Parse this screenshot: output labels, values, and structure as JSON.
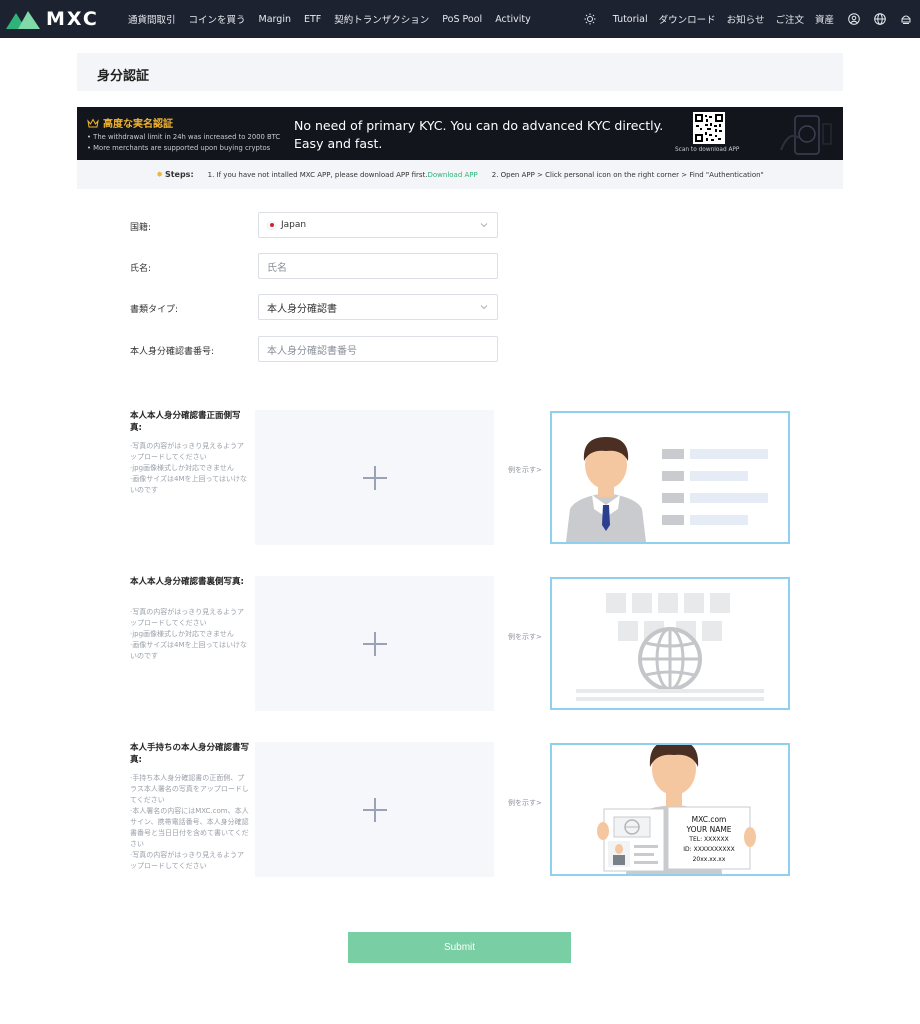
{
  "nav": {
    "brand": "MXC",
    "menu": [
      "通貨間取引",
      "コインを買う",
      "Margin",
      "ETF",
      "契約トランザクション",
      "PoS Pool",
      "Activity"
    ],
    "right_links": [
      "Tutorial",
      "ダウンロード",
      "お知らせ",
      "ご注文",
      "資産"
    ],
    "icons": [
      "sun-icon",
      "user-icon",
      "globe-icon",
      "contract-icon"
    ]
  },
  "page": {
    "title": "身分認証"
  },
  "banner": {
    "title": "高度な実名認証",
    "bullets": [
      "• The withdrawal limit in 24h was increased to 2000 BTC",
      "• More merchants are supported upon buying cryptos"
    ],
    "headline_1": "No need of primary KYC. You can do advanced KYC directly.",
    "headline_2": "Easy and fast.",
    "scan_text": "Scan to download APP"
  },
  "steps": {
    "label": "Steps:",
    "step1_text": "1. If you have not intalled MXC APP, please download APP first.",
    "step1_link": "Download APP",
    "step2_text": "2. Open APP > Click personal icon on the right corner > Find \"Authentication\""
  },
  "form": {
    "nationality": {
      "label": "国籍:",
      "value": "Japan"
    },
    "name": {
      "label": "氏名:",
      "placeholder": "氏名"
    },
    "doc_type": {
      "label": "書類タイプ:",
      "value": "本人身分確認書"
    },
    "doc_number": {
      "label": "本人身分確認書番号:",
      "placeholder": "本人身分確認書番号"
    }
  },
  "uploads": [
    {
      "title": "本人本人身分確認書正面側写真:",
      "notes": [
        "·写真の内容がはっきり見えるようアップロードしてください",
        "·jpg画像様式しか対応できません",
        "·画像サイズは4Mを上回ってはいけないのです"
      ],
      "example": "例を示す>"
    },
    {
      "title": "本人本人身分確認書裏側写真:",
      "notes": [
        "·写真の内容がはっきり見えるようアップロードしてください",
        "·jpg画像様式しか対応できません",
        "·画像サイズは4Mを上回ってはいけないのです"
      ],
      "example": "例を示す>"
    },
    {
      "title": "本人手持ちの本人身分確認書写真:",
      "notes": [
        "·手持ち本人身分確認書の正面側、プラス本人署名の写真をアップロードしてください",
        "·本人署名の内容にはMXC.com、本人サイン、携帯電話番号、本人身分確認書番号と当日日付を含めて書いてください",
        "·写真の内容がはっきり見えるようアップロードしてください"
      ],
      "example": "例を示す>"
    }
  ],
  "sample_card": {
    "line1": "MXC.com",
    "line2": "YOUR NAME",
    "line3": "TEL: XXXXXX",
    "line4": "ID:  XXXXXXXXXX",
    "line5": "20xx.xx.xx"
  },
  "submit_label": "Submit",
  "colors": {
    "nav_bg": "#1c2230",
    "accent_green": "#2fb37a",
    "submit_bg": "#79cfa3",
    "banner_gold": "#f0b431"
  }
}
